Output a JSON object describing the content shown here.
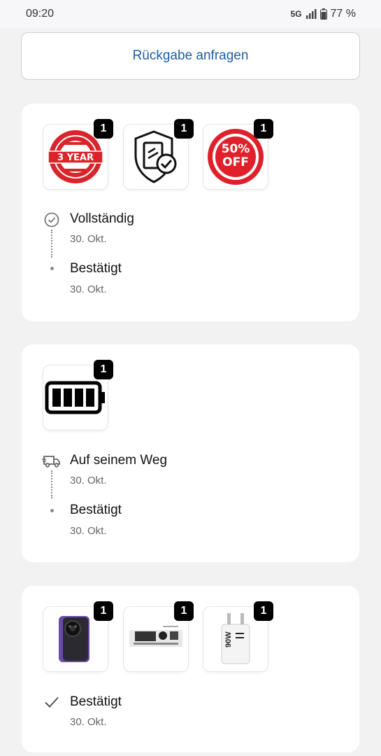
{
  "status_bar": {
    "time": "09:20",
    "network": "5G",
    "battery": "77 %"
  },
  "return_button": {
    "label": "Rückgabe anfragen"
  },
  "order1": {
    "items": [
      {
        "qty": "1",
        "image": "warranty-3-year-seal-icon"
      },
      {
        "qty": "1",
        "image": "protection-shield-document-icon"
      },
      {
        "qty": "1",
        "image": "fifty-percent-off-seal-icon",
        "seal_text": "50% OFF"
      }
    ],
    "timeline": [
      {
        "title": "Vollständig",
        "date": "30. Okt."
      },
      {
        "title": "Bestätigt",
        "date": "30. Okt."
      }
    ]
  },
  "order2": {
    "items": [
      {
        "qty": "1",
        "image": "battery-icon"
      }
    ],
    "timeline": [
      {
        "title": "Auf seinem Weg",
        "date": "30. Okt."
      },
      {
        "title": "Bestätigt",
        "date": "30. Okt."
      }
    ]
  },
  "order3": {
    "items": [
      {
        "qty": "1",
        "image": "smartphone-photo"
      },
      {
        "qty": "1",
        "image": "dock-accessory-photo"
      },
      {
        "qty": "1",
        "image": "charger-photo",
        "charger_text": "90W"
      }
    ],
    "timeline": [
      {
        "title": "Bestätigt",
        "date": "30. Okt."
      }
    ]
  },
  "colors": {
    "accent": "#1b5fa8",
    "badge": "#000000",
    "seal_red": "#e0202a"
  }
}
